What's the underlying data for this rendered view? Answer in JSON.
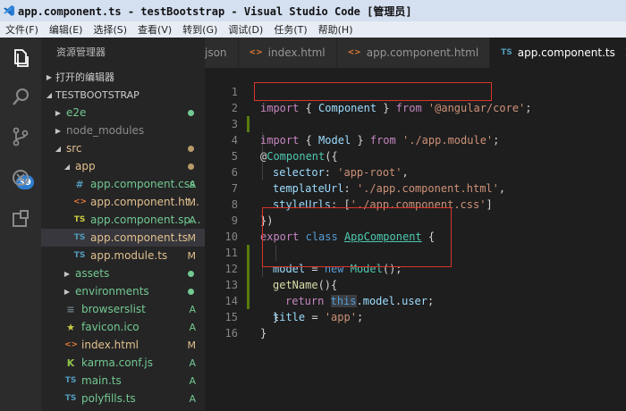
{
  "window": {
    "title": "app.component.ts - testBootstrap - Visual Studio Code [管理员]"
  },
  "menu": [
    "文件(F)",
    "编辑(E)",
    "选择(S)",
    "查看(V)",
    "转到(G)",
    "调试(D)",
    "任务(T)",
    "帮助(H)"
  ],
  "activity_bar": {
    "icons": [
      "explorer-icon",
      "search-icon",
      "source-control-icon",
      "debug-icon",
      "extensions-icon"
    ],
    "scm_badge": "39"
  },
  "sidebar": {
    "title": "资源管理器",
    "open_editors": "打开的编辑器",
    "project": "TESTBOOTSTRAP",
    "items": [
      {
        "label": "e2e",
        "kind": "folder",
        "collapsed": true,
        "status": "",
        "dot": "#73c991"
      },
      {
        "label": "node_modules",
        "kind": "folder",
        "collapsed": true,
        "status": "",
        "dot": ""
      },
      {
        "label": "src",
        "kind": "folder",
        "collapsed": false,
        "status": "",
        "dot": "#b89b6a"
      },
      {
        "label": "app",
        "kind": "folder",
        "collapsed": false,
        "status": "",
        "dot": "#b89b6a"
      },
      {
        "label": "app.component.css",
        "kind": "css",
        "icon": "#",
        "status": "A"
      },
      {
        "label": "app.component.ht...",
        "kind": "html",
        "icon": "<>",
        "status": "M"
      },
      {
        "label": "app.component.sp...",
        "kind": "ts-spec",
        "icon": "TS",
        "status": "A"
      },
      {
        "label": "app.component.ts",
        "kind": "ts",
        "icon": "TS",
        "status": "M"
      },
      {
        "label": "app.module.ts",
        "kind": "ts",
        "icon": "TS",
        "status": "M"
      },
      {
        "label": "assets",
        "kind": "folder",
        "collapsed": true,
        "status": "",
        "dot": "#73c991"
      },
      {
        "label": "environments",
        "kind": "folder",
        "collapsed": true,
        "status": "",
        "dot": "#73c991"
      },
      {
        "label": "browserslist",
        "kind": "file",
        "icon": "≡",
        "status": "A"
      },
      {
        "label": "favicon.ico",
        "kind": "ico",
        "icon": "★",
        "status": "A"
      },
      {
        "label": "index.html",
        "kind": "html",
        "icon": "<>",
        "status": "M"
      },
      {
        "label": "karma.conf.js",
        "kind": "karma",
        "icon": "K",
        "status": "A"
      },
      {
        "label": "main.ts",
        "kind": "ts",
        "icon": "TS",
        "status": "A"
      },
      {
        "label": "polyfills.ts",
        "kind": "ts",
        "icon": "TS",
        "status": "A"
      }
    ]
  },
  "tabs": [
    {
      "label": "json",
      "icon": ""
    },
    {
      "label": "index.html",
      "icon": "<>"
    },
    {
      "label": "app.component.html",
      "icon": "<>"
    },
    {
      "label": "app.component.ts",
      "icon": "TS",
      "active": true
    }
  ],
  "editor": {
    "line_numbers": [
      "1",
      "2",
      "3",
      "4",
      "5",
      "6",
      "7",
      "8",
      "9",
      "10",
      "11",
      "12",
      "13",
      "14",
      "15",
      "16"
    ],
    "tokens": {
      "l1": [
        "import",
        " { ",
        "Component",
        " } ",
        "from",
        " ",
        "'@angular/core'",
        ";"
      ],
      "l2": [
        "import",
        " { ",
        "Model",
        " } ",
        "from",
        " ",
        "'./app.module'",
        ";"
      ],
      "l4": [
        "@",
        "Component",
        "({"
      ],
      "l5": [
        "selector",
        ": ",
        "'app-root'",
        ","
      ],
      "l6": [
        "templateUrl",
        ": ",
        "'./app.component.html'",
        ","
      ],
      "l7": [
        "styleUrls",
        ": [",
        "'./app.component.css'",
        "]"
      ],
      "l8": [
        "})"
      ],
      "l9": [
        "export",
        " ",
        "class",
        " ",
        "AppComponent",
        " {"
      ],
      "l10": [
        "model",
        " = ",
        "new",
        " ",
        "Model",
        "();"
      ],
      "l11": [
        "getName",
        "(){"
      ],
      "l12": [
        "return",
        " ",
        "this",
        ".",
        "model",
        ".",
        "user",
        ";"
      ],
      "l13": [
        "}"
      ],
      "l14": [
        "title",
        " = ",
        "'app'",
        ";"
      ],
      "l15": [
        "}"
      ]
    }
  },
  "colors": {
    "keyword": "#c586c0",
    "storage": "#569cd6",
    "string": "#ce9178",
    "variable": "#9cdcfe",
    "function": "#dcdcaa",
    "class": "#4ec9b0",
    "annotation_box": "#d9342b",
    "git_added": "#73c991",
    "git_modified": "#e2c08d"
  }
}
